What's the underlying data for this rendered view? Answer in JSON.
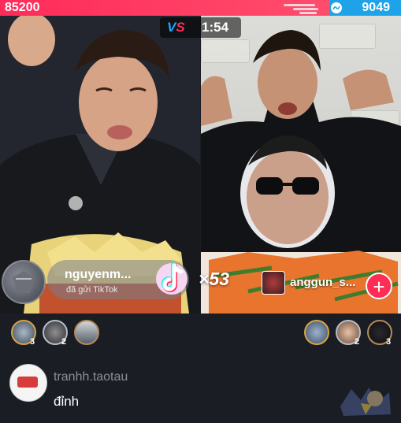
{
  "battle": {
    "left_score": "85200",
    "right_score": "9049",
    "vs_label": {
      "v": "V",
      "s": "S"
    },
    "timer": "1:54"
  },
  "gift": {
    "sender": "nguyenm...",
    "message": "đã gửi TikTok",
    "multiplier": "×53",
    "icon": "tiktok-logo-gift"
  },
  "opponent": {
    "host_name": "anggun_s...",
    "follow_label": "+"
  },
  "supporters": {
    "left": [
      {
        "rank": "3"
      },
      {
        "rank": "2"
      },
      {
        "rank": ""
      }
    ],
    "right": [
      {
        "rank": ""
      },
      {
        "rank": "2"
      },
      {
        "rank": "3"
      }
    ]
  },
  "comment": {
    "username": "tranhh.taotau",
    "text": "đỉnh"
  },
  "colors": {
    "left_team": "#ff2b59",
    "right_team": "#1fa3e8",
    "follow": "#ff2d55"
  }
}
